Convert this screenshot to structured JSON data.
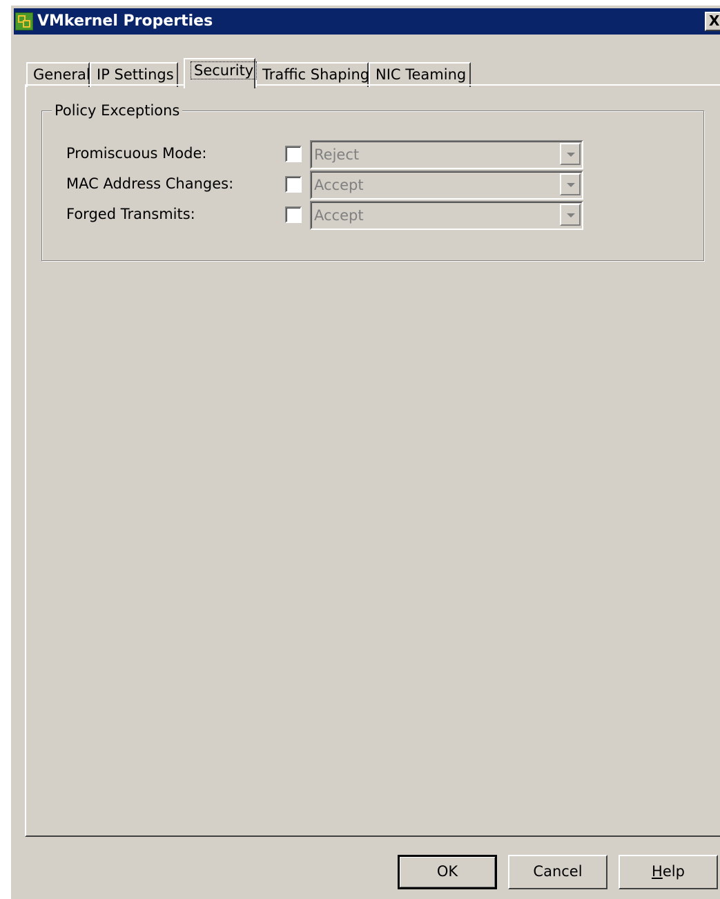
{
  "window": {
    "title": "VMkernel Properties",
    "close_glyph": "X"
  },
  "tabs": [
    {
      "label": "General"
    },
    {
      "label": "IP Settings"
    },
    {
      "label": "Security",
      "active": true
    },
    {
      "label": "Traffic Shaping"
    },
    {
      "label": "NIC Teaming"
    }
  ],
  "policy": {
    "group_title": "Policy Exceptions",
    "rows": [
      {
        "label": "Promiscuous Mode:",
        "checked": false,
        "value": "Reject"
      },
      {
        "label": "MAC Address Changes:",
        "checked": false,
        "value": "Accept"
      },
      {
        "label": "Forged Transmits:",
        "checked": false,
        "value": "Accept"
      }
    ]
  },
  "buttons": {
    "ok": "OK",
    "cancel": "Cancel",
    "help_mnemonic": "H",
    "help_rest": "elp"
  }
}
